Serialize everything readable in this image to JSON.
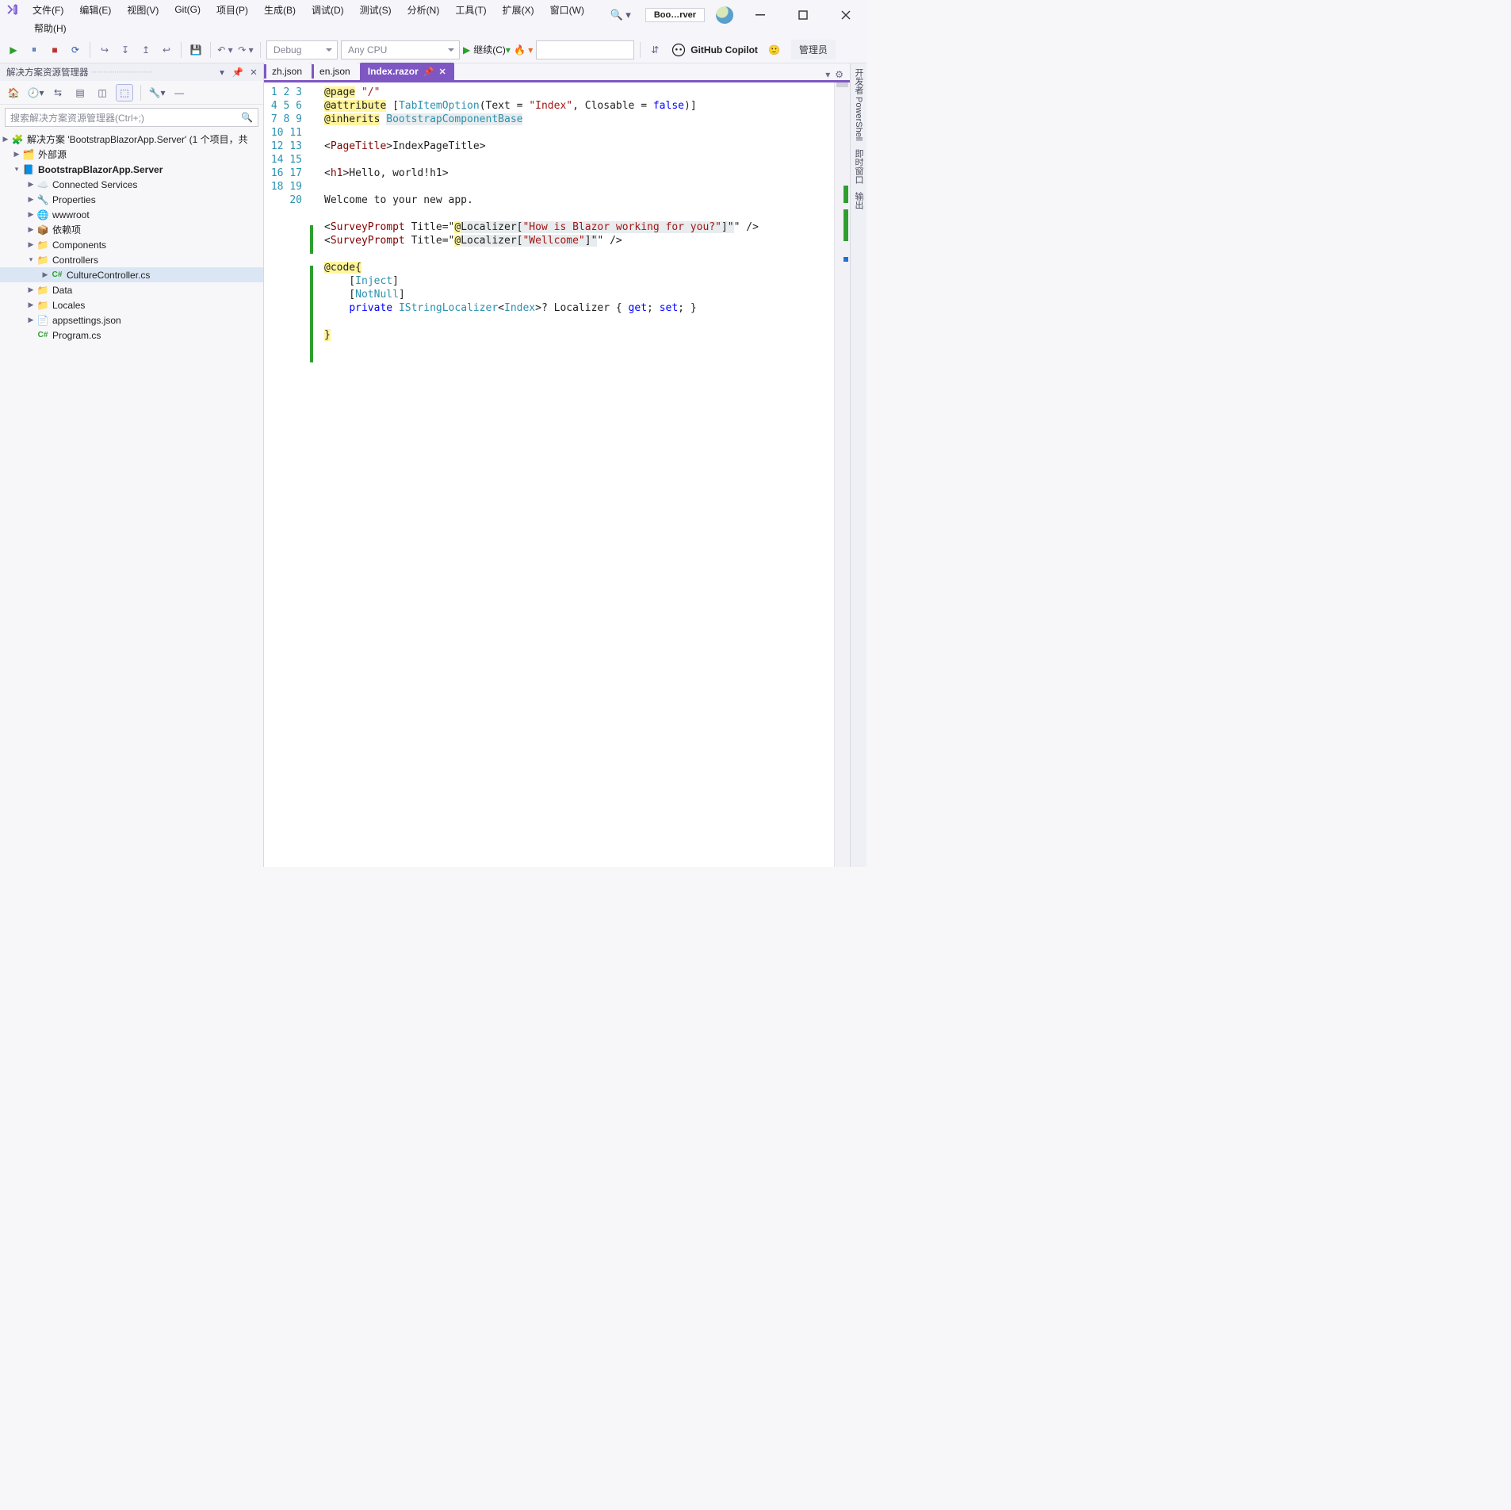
{
  "menu": {
    "items": [
      "文件(F)",
      "编辑(E)",
      "视图(V)",
      "Git(G)",
      "项目(P)",
      "生成(B)",
      "调试(D)",
      "测试(S)",
      "分析(N)",
      "工具(T)",
      "扩展(X)",
      "窗口(W)"
    ],
    "row2": [
      "帮助(H)"
    ]
  },
  "titlebar": {
    "solution_chip": "Boo…rver"
  },
  "toolbar": {
    "config": "Debug",
    "platform": "Any CPU",
    "run_label": "继续(C)",
    "copilot": "GitHub Copilot",
    "admin": "管理员"
  },
  "solution_explorer": {
    "title": "解决方案资源管理器",
    "search_placeholder": "搜索解决方案资源管理器(Ctrl+;)",
    "nodes": {
      "solution": "解决方案 'BootstrapBlazorApp.Server' (1 个项目，共",
      "external": "外部源",
      "project": "BootstrapBlazorApp.Server",
      "connected": "Connected Services",
      "properties": "Properties",
      "wwwroot": "wwwroot",
      "deps": "依赖项",
      "components": "Components",
      "controllers": "Controllers",
      "culturectrl": "CultureController.cs",
      "data": "Data",
      "locales": "Locales",
      "appsettings": "appsettings.json",
      "program": "Program.cs"
    }
  },
  "editor": {
    "tabs": [
      "zh.json",
      "en.json",
      "Index.razor"
    ],
    "active_tab_index": 2,
    "line_count": 20,
    "code": {
      "l1": {
        "dir": "@page",
        "s": "\"/\""
      },
      "l2": {
        "dir": "@attribute",
        "b1": "[",
        "t": "TabItemOption",
        "rest": "(Text = ",
        "s1": "\"Index\"",
        "rest2": ", Closable = ",
        "kw": "false",
        "end": ")]"
      },
      "l3": {
        "dir": "@inherits",
        "t": "BootstrapComponentBase"
      },
      "l5": {
        "open": "<",
        "tag": "PageTitle",
        "gt": ">",
        "txt": "Index",
        "close": "</",
        "tag2": "PageTitle",
        "end": ">"
      },
      "l7": {
        "open": "<",
        "tag": "h1",
        "gt": ">",
        "txt": "Hello, world!",
        "close": "</",
        "tag2": "h1",
        "end": ">"
      },
      "l9": "Welcome to your new app.",
      "l11": {
        "open": "<",
        "tag": "SurveyPrompt",
        "sp": " ",
        "attr": "Title",
        "eq": "=\"",
        "at": "@",
        "loc": "Localizer[",
        "s": "\"How is Blazor working for you?\"",
        "end1": "]\"",
        "end2": " />"
      },
      "l12": {
        "open": "<",
        "tag": "SurveyPrompt",
        "sp": " ",
        "attr": "Title",
        "eq": "=\"",
        "at": "@",
        "loc": "Localizer[",
        "s": "\"Wellcome\"",
        "end1": "]\"",
        "end2": " />"
      },
      "l14": {
        "dir": "@code",
        "brace": "{"
      },
      "l15": {
        "b1": "[",
        "t": "Inject",
        "b2": "]"
      },
      "l16": {
        "b1": "[",
        "t": "NotNull",
        "b2": "]"
      },
      "l17": {
        "kw": "private",
        "sp": " ",
        "t1": "IStringLocalizer",
        "lt": "<",
        "t2": "Index",
        "gt": ">? Localizer { ",
        "g": "get",
        "semi": "; ",
        "s": "set",
        "end": "; }"
      },
      "l19": "}"
    }
  },
  "side_tabs": [
    "开发者 PowerShell",
    "即时窗口",
    "输出"
  ]
}
